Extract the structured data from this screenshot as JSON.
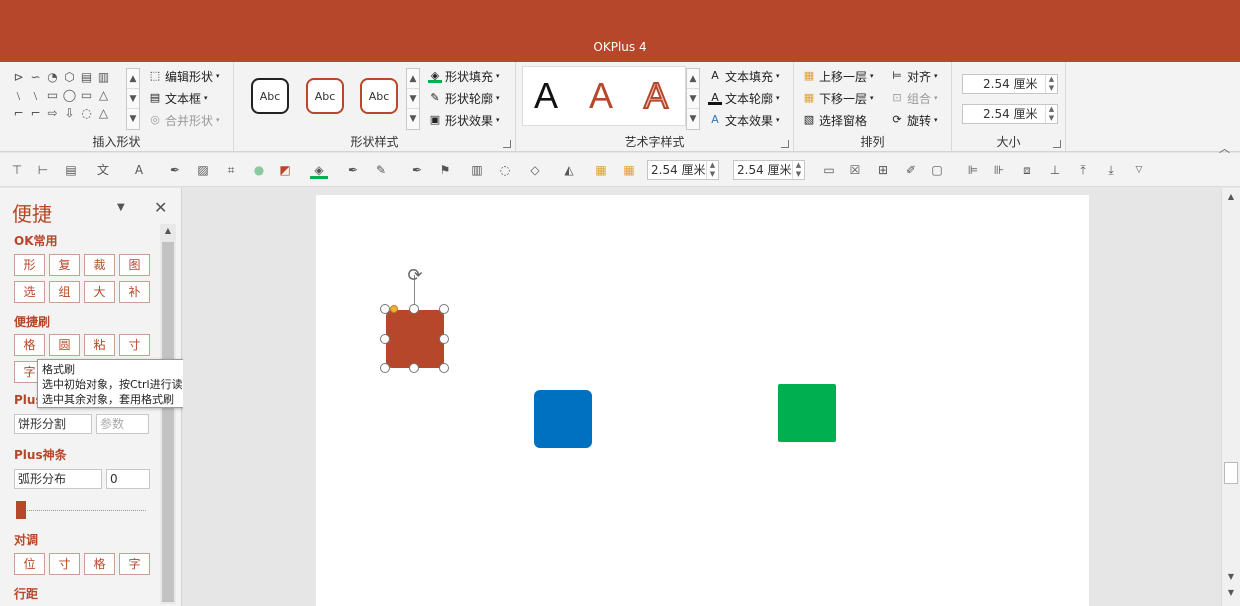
{
  "app": {
    "title": "OKPlus 4"
  },
  "ribbon": {
    "insert_shapes": {
      "label": "插入形状",
      "edit_shape": "编辑形状",
      "text_box": "文本框",
      "merge_shapes": "合并形状",
      "gallery_icons": [
        "⊳",
        "∽",
        "◔",
        "⬡",
        "▤",
        "▥",
        "﹨",
        "﹨",
        "▭",
        "◯",
        "▭",
        "△",
        "⌐",
        "⌐",
        "⇨",
        "⇩",
        "◌",
        "△"
      ]
    },
    "shape_styles": {
      "label": "形状样式",
      "sample": "Abc",
      "fill": "形状填充",
      "outline": "形状轮廓",
      "effects": "形状效果"
    },
    "wordart": {
      "label": "艺术字样式",
      "letter": "A",
      "text_fill": "文本填充",
      "text_outline": "文本轮廓",
      "text_effects": "文本效果"
    },
    "arrange": {
      "label": "排列",
      "bring_forward": "上移一层",
      "send_backward": "下移一层",
      "selection_pane": "选择窗格",
      "align": "对齐",
      "group": "组合",
      "rotate": "旋转"
    },
    "size": {
      "label": "大小",
      "height": "2.54 厘米",
      "width": "2.54 厘米"
    }
  },
  "toolbar": {
    "width_value": "2.54 厘米",
    "height_value": "2.54 厘米"
  },
  "pane": {
    "title": "便捷",
    "sections": {
      "ok_common": {
        "label": "OK常用",
        "buttons": [
          "形",
          "复",
          "裁",
          "图",
          "选",
          "组",
          "大",
          "补"
        ]
      },
      "brush": {
        "label": "便捷刷",
        "buttons": [
          "格",
          "圆",
          "粘",
          "寸",
          "字"
        ]
      },
      "plus": {
        "label": "Plus",
        "input_value": "饼形分割",
        "param_placeholder": "参数"
      },
      "plus_magic": {
        "label": "Plus神条",
        "input_value": "弧形分布",
        "number_value": "0",
        "slider_fraction": 0.0
      },
      "align_adjust": {
        "label": "对调",
        "buttons": [
          "位",
          "寸",
          "格",
          "字"
        ]
      },
      "line_spacing": {
        "label": "行距"
      }
    },
    "tooltip": {
      "title": "格式刷",
      "line1": "选中初始对象，按Ctrl进行读取;",
      "line2": "选中其余对象，套用格式刷"
    }
  },
  "colors": {
    "accent": "#b7472a",
    "shape_red": "#b7472a",
    "shape_blue": "#0070c0",
    "shape_green": "#00b050"
  }
}
